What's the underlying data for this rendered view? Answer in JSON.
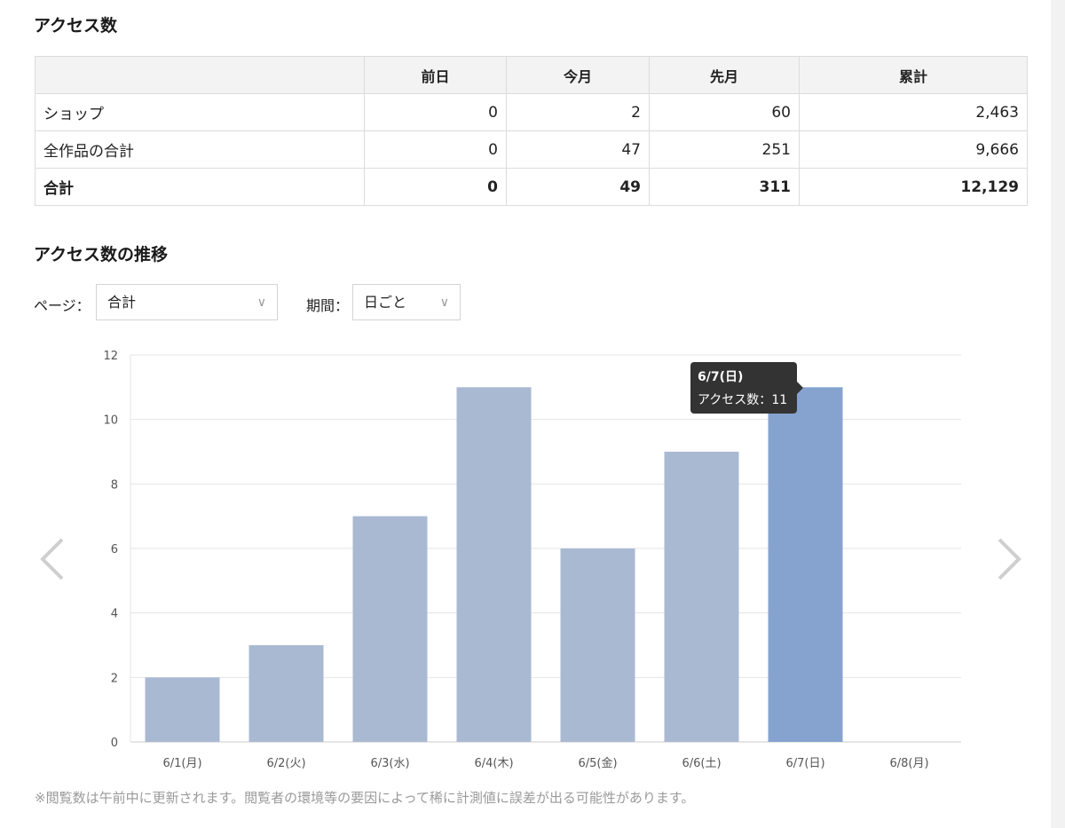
{
  "headings": {
    "access": "アクセス数",
    "trend": "アクセス数の推移"
  },
  "table": {
    "columns": [
      "",
      "前日",
      "今月",
      "先月",
      "累計"
    ],
    "rows": [
      {
        "label": "ショップ",
        "values": [
          "0",
          "2",
          "60",
          "2,463"
        ]
      },
      {
        "label": "全作品の合計",
        "values": [
          "0",
          "47",
          "251",
          "9,666"
        ]
      },
      {
        "label": "合計",
        "values": [
          "0",
          "49",
          "311",
          "12,129"
        ]
      }
    ]
  },
  "filters": {
    "page_label": "ページ：",
    "page_value": "合計",
    "period_label": "期間：",
    "period_value": "日ごと"
  },
  "chart_data": {
    "type": "bar",
    "categories": [
      "6/1(月)",
      "6/2(火)",
      "6/3(水)",
      "6/4(木)",
      "6/5(金)",
      "6/6(土)",
      "6/7(日)",
      "6/8(月)"
    ],
    "values": [
      2,
      3,
      7,
      11,
      6,
      9,
      11,
      0
    ],
    "ylim": [
      0,
      12
    ],
    "yticks": [
      "0",
      "2",
      "4",
      "6",
      "8",
      "10",
      "12"
    ],
    "highlight_index": 6,
    "colors": {
      "bar": "#aab9d2",
      "highlight": "#86a3cf",
      "grid": "#e6e6e6",
      "axis": "#cccccc"
    }
  },
  "tooltip": {
    "title": "6/7(日)",
    "label": "アクセス数：",
    "value": "11"
  },
  "nav": {
    "prev_icon": "chevron-left-icon",
    "next_icon": "chevron-right-icon"
  },
  "note": "※閲覧数は午前中に更新されます。閲覧者の環境等の要因によって稀に計測値に誤差が出る可能性があります。"
}
